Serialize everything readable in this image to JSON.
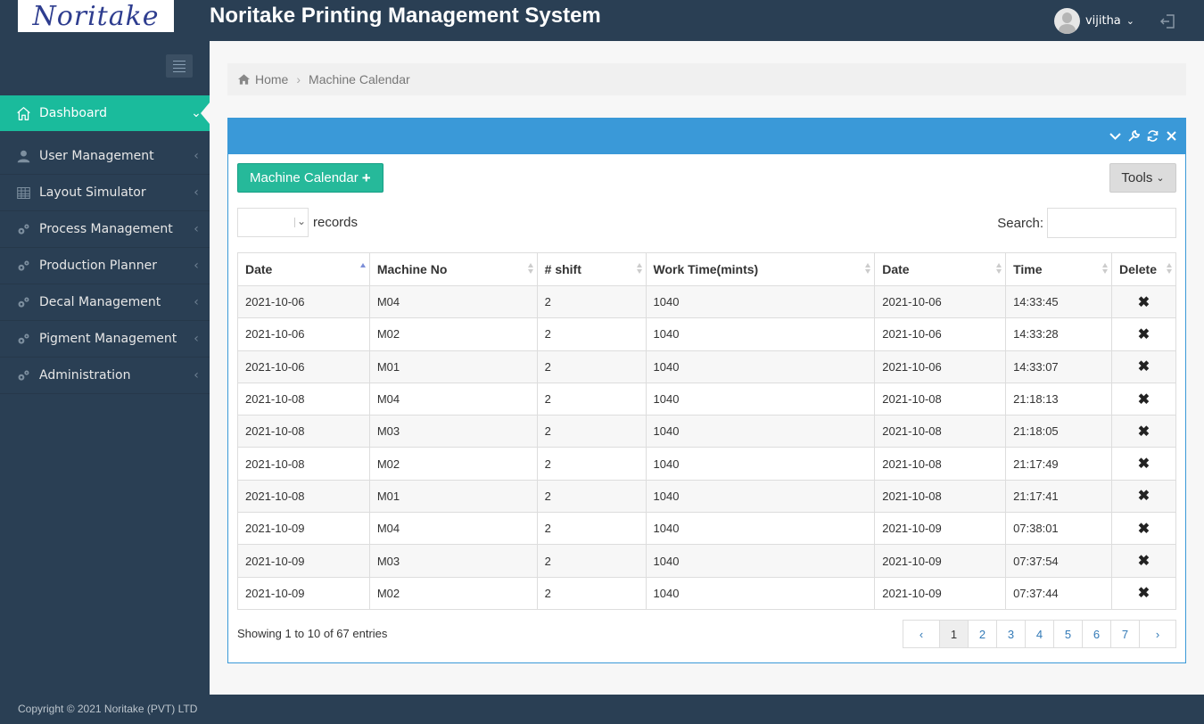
{
  "app": {
    "logo_text": "Noritake",
    "title": "Noritake Printing Management System",
    "user_name": "vijitha",
    "copyright": "Copyright © 2021 Noritake (PVT) LTD"
  },
  "sidebar": {
    "items": [
      {
        "label": "Dashboard",
        "icon": "home-icon",
        "active": true
      },
      {
        "label": "User Management",
        "icon": "user-icon"
      },
      {
        "label": "Layout Simulator",
        "icon": "table-icon"
      },
      {
        "label": "Process Management",
        "icon": "cogs-icon"
      },
      {
        "label": "Production Planner",
        "icon": "cogs-icon"
      },
      {
        "label": "Decal Management",
        "icon": "cogs-icon"
      },
      {
        "label": "Pigment Management",
        "icon": "cogs-icon"
      },
      {
        "label": "Administration",
        "icon": "cogs-icon"
      }
    ]
  },
  "breadcrumb": {
    "home": "Home",
    "current": "Machine Calendar"
  },
  "toolbar": {
    "add_label": "Machine Calendar",
    "tools_label": "Tools"
  },
  "table_controls": {
    "length_value": "",
    "records_label": "records",
    "search_label": "Search:",
    "search_value": ""
  },
  "table": {
    "columns": [
      "Date",
      "Machine No",
      "# shift",
      "Work Time(mints)",
      "Date",
      "Time",
      "Delete"
    ],
    "rows": [
      [
        "2021-10-06",
        "M04",
        "2",
        "1040",
        "2021-10-06",
        "14:33:45"
      ],
      [
        "2021-10-06",
        "M02",
        "2",
        "1040",
        "2021-10-06",
        "14:33:28"
      ],
      [
        "2021-10-06",
        "M01",
        "2",
        "1040",
        "2021-10-06",
        "14:33:07"
      ],
      [
        "2021-10-08",
        "M04",
        "2",
        "1040",
        "2021-10-08",
        "21:18:13"
      ],
      [
        "2021-10-08",
        "M03",
        "2",
        "1040",
        "2021-10-08",
        "21:18:05"
      ],
      [
        "2021-10-08",
        "M02",
        "2",
        "1040",
        "2021-10-08",
        "21:17:49"
      ],
      [
        "2021-10-08",
        "M01",
        "2",
        "1040",
        "2021-10-08",
        "21:17:41"
      ],
      [
        "2021-10-09",
        "M04",
        "2",
        "1040",
        "2021-10-09",
        "07:38:01"
      ],
      [
        "2021-10-09",
        "M03",
        "2",
        "1040",
        "2021-10-09",
        "07:37:54"
      ],
      [
        "2021-10-09",
        "M02",
        "2",
        "1040",
        "2021-10-09",
        "07:37:44"
      ]
    ],
    "delete_symbol": "✖"
  },
  "footer": {
    "info": "Showing 1 to 10 of 67 entries",
    "pages": [
      "1",
      "2",
      "3",
      "4",
      "5",
      "6",
      "7"
    ],
    "current_page": "1",
    "prev": "‹",
    "next": "›"
  },
  "colors": {
    "sidebar": "#2a3f54",
    "active": "#1abb9c",
    "panel_head": "#3a99d8",
    "add_button": "#26b99a"
  }
}
